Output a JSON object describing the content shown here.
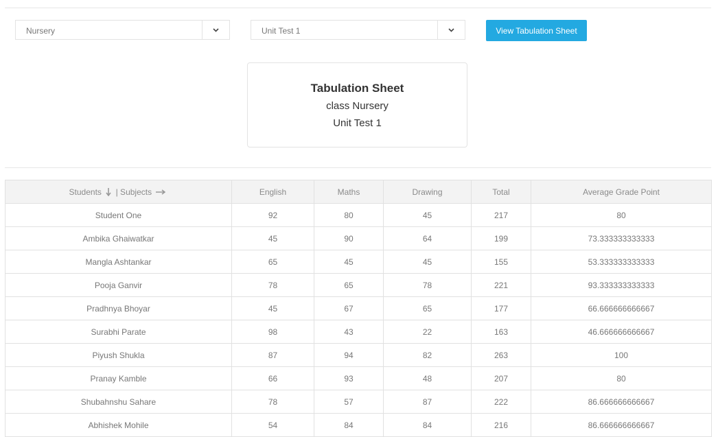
{
  "filters": {
    "class_value": "Nursery",
    "exam_value": "Unit Test 1",
    "view_button_label": "View Tabulation Sheet"
  },
  "card": {
    "title": "Tabulation Sheet",
    "class_line": "class Nursery",
    "exam_line": "Unit Test 1"
  },
  "table": {
    "header_students": "Students",
    "header_subjects": "| Subjects",
    "columns": [
      "English",
      "Maths",
      "Drawing",
      "Total",
      "Average Grade Point"
    ],
    "rows": [
      {
        "student": "Student One",
        "english": "92",
        "maths": "80",
        "drawing": "45",
        "total": "217",
        "avg": "80"
      },
      {
        "student": "Ambika Ghaiwatkar",
        "english": "45",
        "maths": "90",
        "drawing": "64",
        "total": "199",
        "avg": "73.333333333333"
      },
      {
        "student": "Mangla Ashtankar",
        "english": "65",
        "maths": "45",
        "drawing": "45",
        "total": "155",
        "avg": "53.333333333333"
      },
      {
        "student": "Pooja Ganvir",
        "english": "78",
        "maths": "65",
        "drawing": "78",
        "total": "221",
        "avg": "93.333333333333"
      },
      {
        "student": "Pradhnya Bhoyar",
        "english": "45",
        "maths": "67",
        "drawing": "65",
        "total": "177",
        "avg": "66.666666666667"
      },
      {
        "student": "Surabhi Parate",
        "english": "98",
        "maths": "43",
        "drawing": "22",
        "total": "163",
        "avg": "46.666666666667"
      },
      {
        "student": "Piyush Shukla",
        "english": "87",
        "maths": "94",
        "drawing": "82",
        "total": "263",
        "avg": "100"
      },
      {
        "student": "Pranay Kamble",
        "english": "66",
        "maths": "93",
        "drawing": "48",
        "total": "207",
        "avg": "80"
      },
      {
        "student": "Shubahnshu Sahare",
        "english": "78",
        "maths": "57",
        "drawing": "87",
        "total": "222",
        "avg": "86.666666666667"
      },
      {
        "student": "Abhishek Mohile",
        "english": "54",
        "maths": "84",
        "drawing": "84",
        "total": "216",
        "avg": "86.666666666667"
      }
    ]
  }
}
